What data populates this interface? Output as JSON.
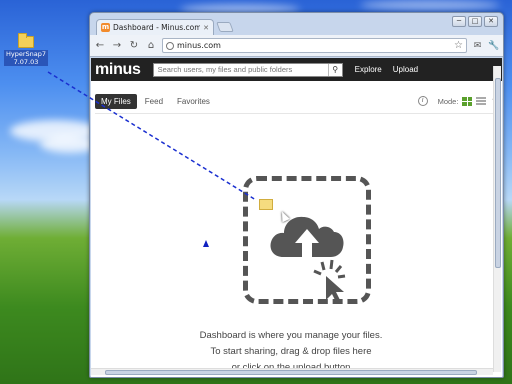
{
  "desktop": {
    "icon_label_line1": "HyperSnap7",
    "icon_label_line2": "7.07.03"
  },
  "browser": {
    "tab_favicon": "m",
    "tab_title": "Dashboard - Minus.com",
    "url": "minus.com",
    "window_buttons": [
      "─",
      "□",
      "✕"
    ]
  },
  "site": {
    "logo": "minus",
    "search_placeholder": "Search users, my files and public folders",
    "nav_links": [
      "Explore",
      "Upload"
    ],
    "tabs": [
      {
        "label": "My Files",
        "active": true
      },
      {
        "label": "Feed",
        "active": false
      },
      {
        "label": "Favorites",
        "active": false
      }
    ],
    "mode_label": "Mode:",
    "accent_color": "#5aa02c"
  },
  "dropzone": {
    "line1": "Dashboard is where you manage your files.",
    "line2": "To start sharing, drag & drop files here",
    "line3": "or click on the upload button"
  }
}
